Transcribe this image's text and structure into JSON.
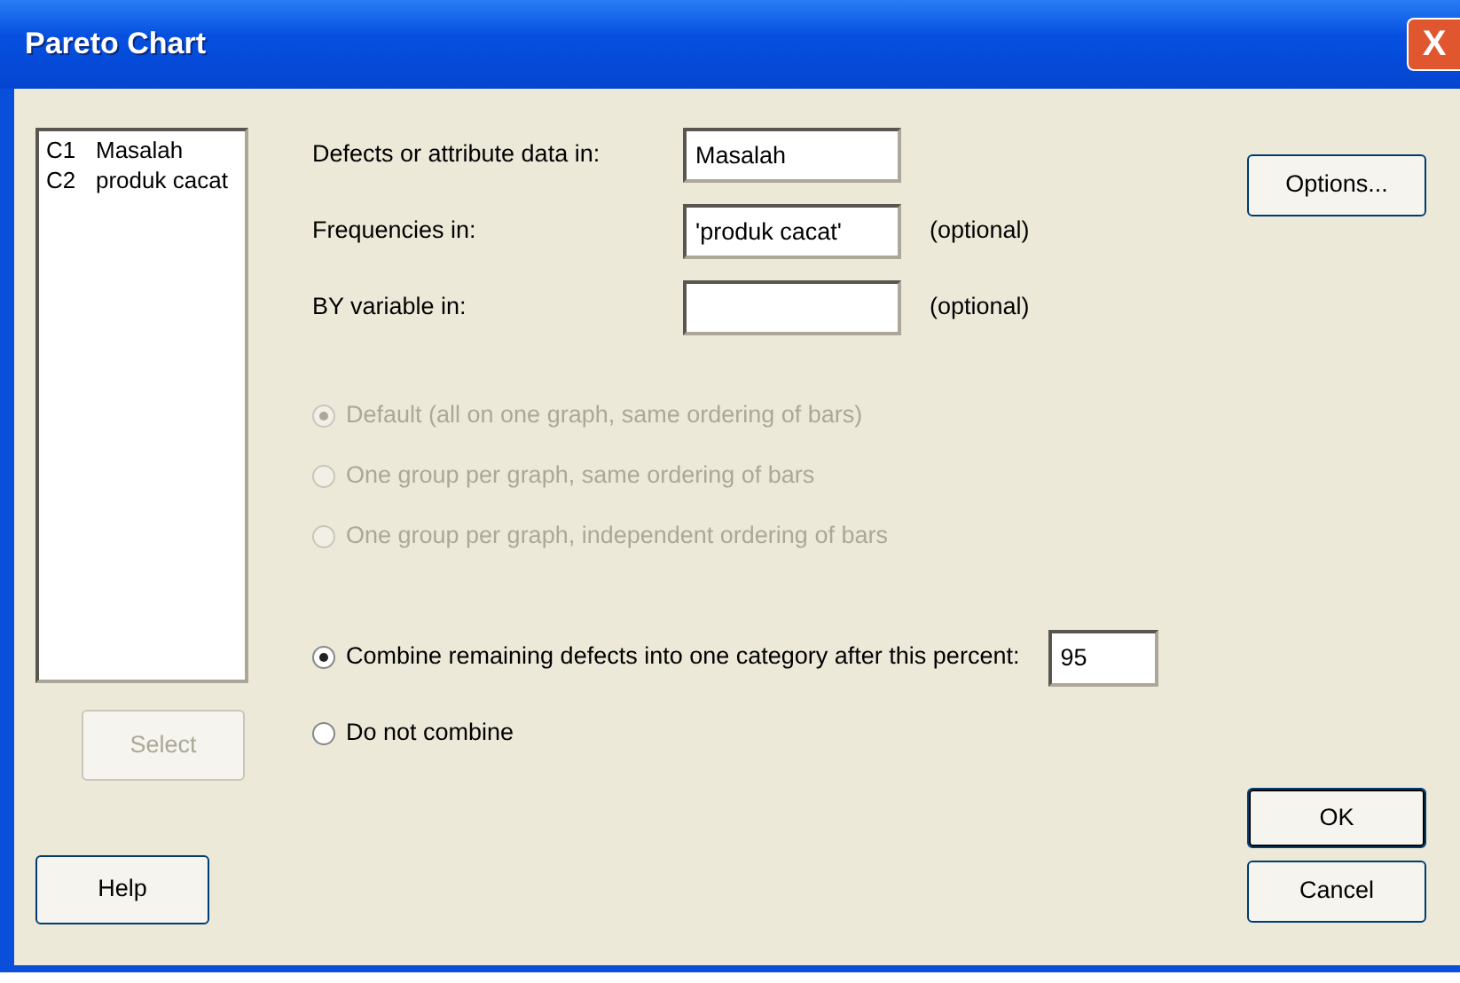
{
  "window": {
    "title": "Pareto Chart",
    "close": "X"
  },
  "variables": [
    {
      "column": "C1",
      "name": "Masalah"
    },
    {
      "column": "C2",
      "name": "produk cacat"
    }
  ],
  "fields": [
    {
      "label": "Defects or attribute data in:",
      "value": "Masalah"
    },
    {
      "label": "Frequencies in:",
      "value": "'produk cacat'",
      "note": "(optional)"
    },
    {
      "label": "BY variable in:",
      "note": "(optional)"
    }
  ],
  "by_options": [
    {
      "label": "Default (all on one graph, same ordering of bars)",
      "selected": true,
      "disabled": true
    },
    {
      "label": "One group per graph, same ordering of bars",
      "selected": false,
      "disabled": true
    },
    {
      "label": "One group per graph, independent ordering of bars",
      "selected": false,
      "disabled": true
    }
  ],
  "combine_options": [
    {
      "label": "Combine remaining defects into one category after this percent:",
      "selected": true,
      "percent": "95"
    },
    {
      "label": "Do not combine",
      "selected": false,
      "disabled": false
    }
  ],
  "buttons": {
    "select": {
      "label": "Select",
      "disabled": true
    },
    "help": {
      "label": "Help"
    },
    "options": {
      "label": "Options..."
    },
    "ok": {
      "label": "OK",
      "default": true
    },
    "cancel": {
      "label": "Cancel"
    }
  }
}
